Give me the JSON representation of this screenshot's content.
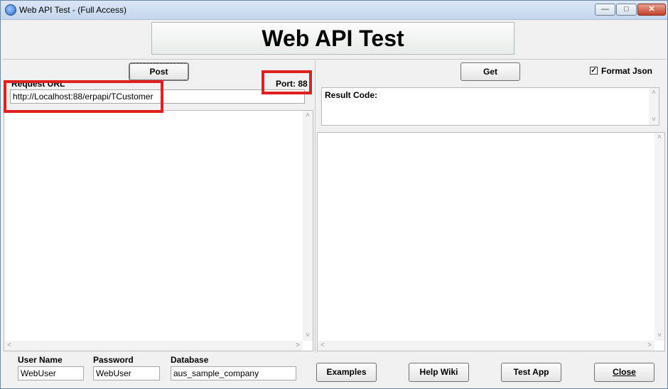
{
  "window": {
    "title": "Web API Test - (Full Access)"
  },
  "header": {
    "title": "Web API Test"
  },
  "left": {
    "post_label": "Post",
    "request_url_label": "Request URL",
    "request_url_value": "http://Localhost:88/erpapi/TCustomer",
    "port_text": "Port: 88"
  },
  "right": {
    "get_label": "Get",
    "format_json_label": "Format Json",
    "format_json_checked": true,
    "result_code_label": "Result Code:"
  },
  "footer": {
    "user_name_label": "User Name",
    "user_name_value": "WebUser",
    "password_label": "Password",
    "password_value": "WebUser",
    "database_label": "Database",
    "database_value": "aus_sample_company",
    "examples_label": "Examples",
    "help_wiki_label": "Help Wiki",
    "test_app_label": "Test App",
    "close_label": "Close"
  },
  "annotations": {
    "highlight_color": "#e02020"
  }
}
